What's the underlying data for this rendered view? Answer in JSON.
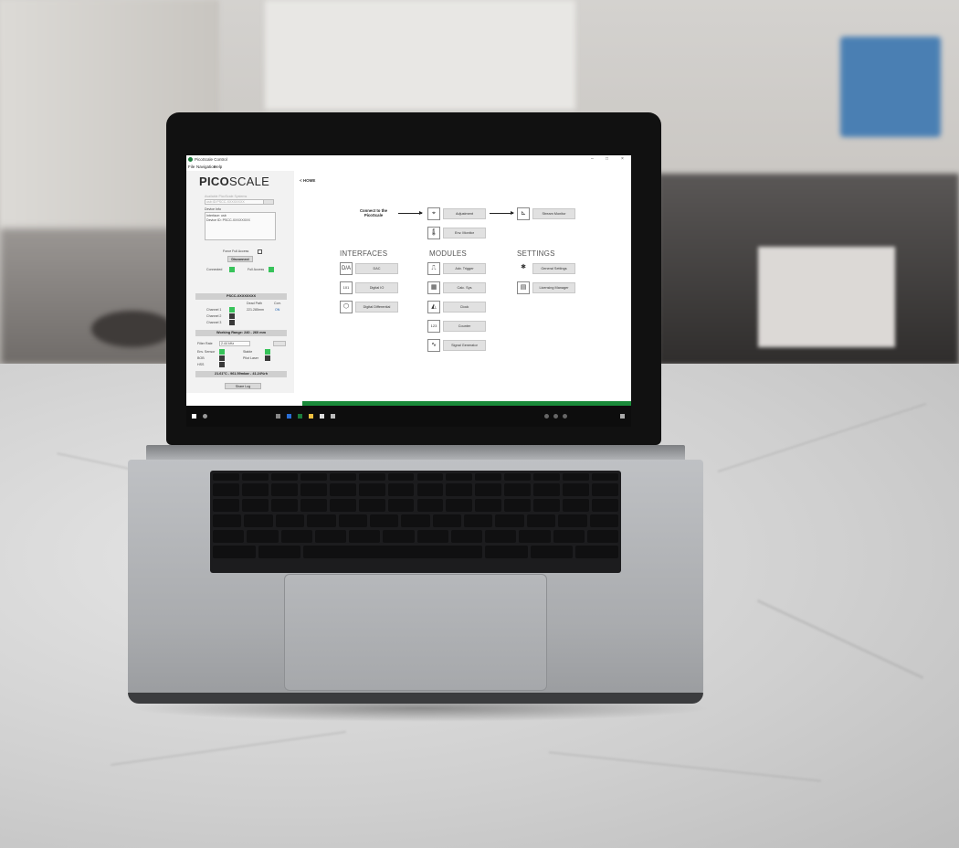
{
  "window": {
    "title": "PicoScale Control",
    "min": "–",
    "max": "□",
    "close": "×"
  },
  "menu": [
    "File",
    "Navigation",
    "Help"
  ],
  "left": {
    "logo_bold": "PICO",
    "logo_rest": "SCALE",
    "available_label": "Available PicoScale Systems",
    "available_value": "usb:ID:PSCC-XXXXXXXX",
    "device_info_label": "Device Info",
    "device_info_line1": "Interface: usb",
    "device_info_line2": "Device ID: PSCC-XXXXXXXX",
    "force_full_access": "Force Full Access",
    "disconnect": "Disconnect",
    "connected": "Connected",
    "full_access": "Full Access",
    "device_bar": "PSCC-XXXXXXXX",
    "col_dead_path": "Dead Path",
    "col_corr": "Corr.",
    "channel1": "Channel 1",
    "channel1_value": "221.285mm",
    "channel1_corr": "ON",
    "channel2": "Channel 2",
    "channel3": "Channel 3",
    "working_range": "Working Range: 240 - 260 mm",
    "filter_rate": "Filter Rate",
    "filter_value": "2.44 kHz",
    "env_sensor": "Env. Sensor",
    "stable": "Stable",
    "bob": "BOB",
    "pilot_laser": "Pilot Laser",
    "hss": "HSS",
    "env_readout": "21.61°C - 961.59mbar - 41.24%rh",
    "share_log": "Share Log"
  },
  "main": {
    "home": "< HOME",
    "connect": "Connect to the PicoScale",
    "adjustment": "Adjustment",
    "env_monitor": "Env. Monitor",
    "stream_monitor": "Stream Monitor",
    "interfaces": "INTERFACES",
    "modules": "MODULES",
    "settings": "SETTINGS",
    "dac": "DAC",
    "digital_io": "Digital IO",
    "digital_diff": "Digital Differential",
    "adv_trigger": "Adv. Trigger",
    "calc_sys": "Calc. Sys",
    "clock": "Clock",
    "counter": "Counter",
    "signal_gen": "Signal Generator",
    "general_settings": "General Settings",
    "licensing": "Licensing Manager"
  }
}
